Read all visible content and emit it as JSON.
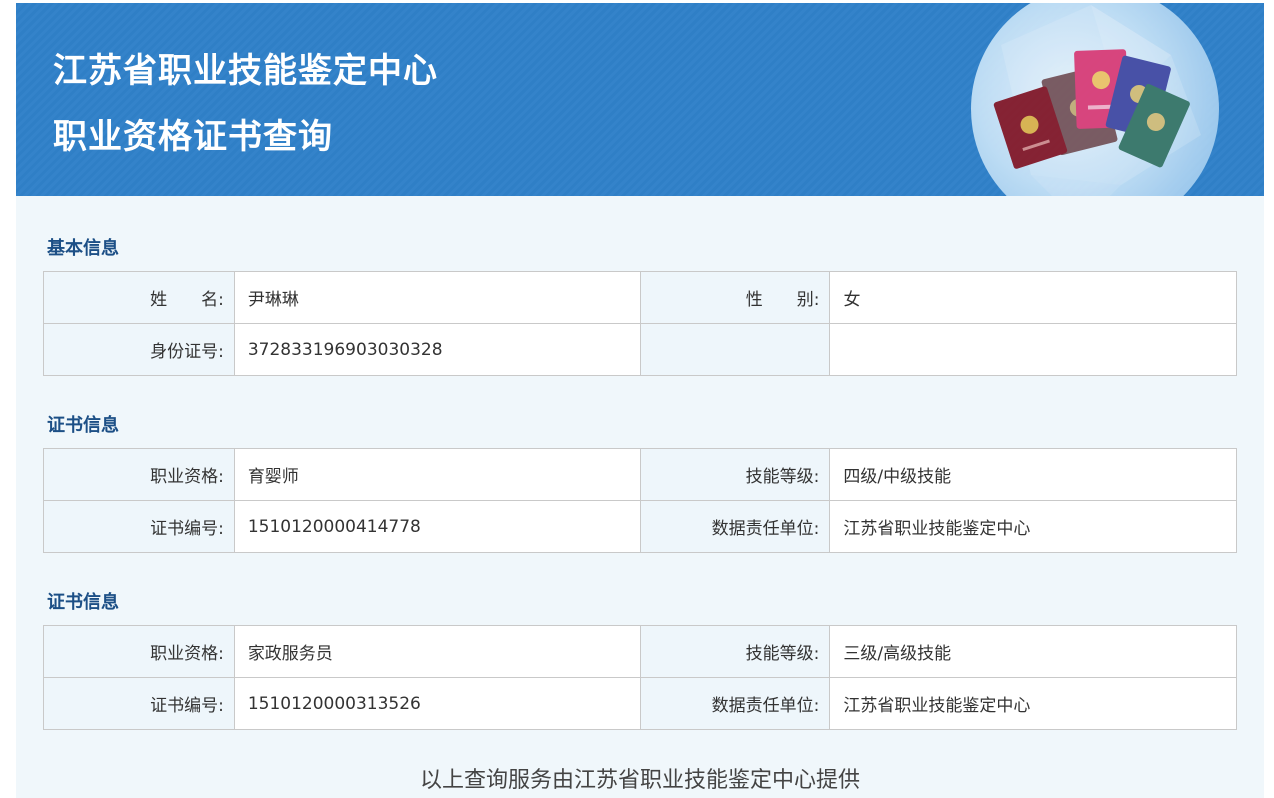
{
  "header": {
    "title_line1": "江苏省职业技能鉴定中心",
    "title_line2": "职业资格证书查询"
  },
  "basic": {
    "section_title": "基本信息",
    "name_label": "姓　　名:",
    "name_value": "尹琳琳",
    "gender_label": "性　　别:",
    "gender_value": "女",
    "id_label": "身份证号:",
    "id_value": "372833196903030328"
  },
  "certificates": [
    {
      "section_title": "证书信息",
      "qualification_label": "职业资格:",
      "qualification_value": "育婴师",
      "level_label": "技能等级:",
      "level_value": "四级/中级技能",
      "cert_no_label": "证书编号:",
      "cert_no_value": "1510120000414778",
      "unit_label": "数据责任单位:",
      "unit_value": "江苏省职业技能鉴定中心"
    },
    {
      "section_title": "证书信息",
      "qualification_label": "职业资格:",
      "qualification_value": "家政服务员",
      "level_label": "技能等级:",
      "level_value": "三级/高级技能",
      "cert_no_label": "证书编号:",
      "cert_no_value": "1510120000313526",
      "unit_label": "数据责任单位:",
      "unit_value": "江苏省职业技能鉴定中心"
    }
  ],
  "footer": {
    "text": "以上查询服务由江苏省职业技能鉴定中心提供"
  },
  "colors": {
    "header_blue": "#2f7fc6",
    "section_title": "#1c4f86",
    "label_bg": "#eef6fb",
    "page_bg": "#f0f7fb"
  },
  "icons": {
    "header_illustration": "certificate-booklets-icon"
  }
}
